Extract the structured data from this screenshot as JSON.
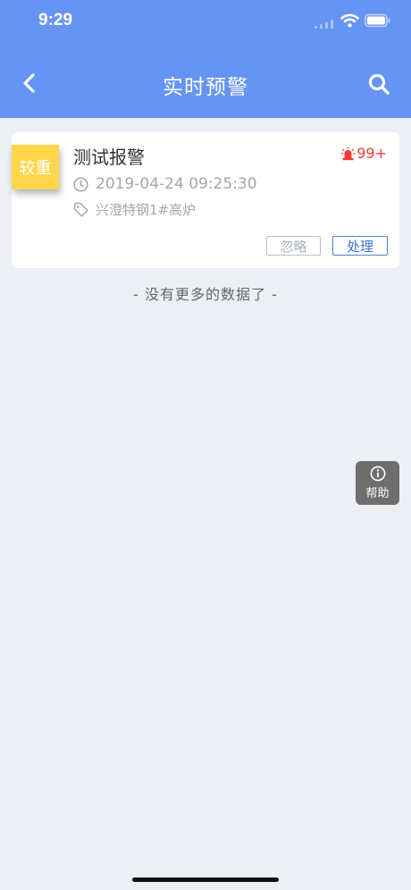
{
  "status_bar": {
    "time": "9:29",
    "icons": [
      "signal-icon",
      "wifi-icon",
      "battery-icon"
    ]
  },
  "header": {
    "title": "实时预警",
    "back_icon": "chevron-left-icon",
    "search_icon": "search-icon",
    "background_color": "#6594f3"
  },
  "alarms": [
    {
      "level": "较重",
      "level_color": "#ffd64b",
      "title": "测试报警",
      "count": "99+",
      "count_color": "#ee3b36",
      "time": "2019-04-24 09:25:30",
      "location": "兴澄特钢1#高炉",
      "ignore_label": "忽略",
      "handle_label": "处理"
    }
  ],
  "list_footer": "- 没有更多的数据了 -",
  "help": {
    "label": "帮助",
    "icon": "info-icon"
  },
  "colors": {
    "page_background": "#eceff3",
    "primary": "#3d73d2"
  }
}
